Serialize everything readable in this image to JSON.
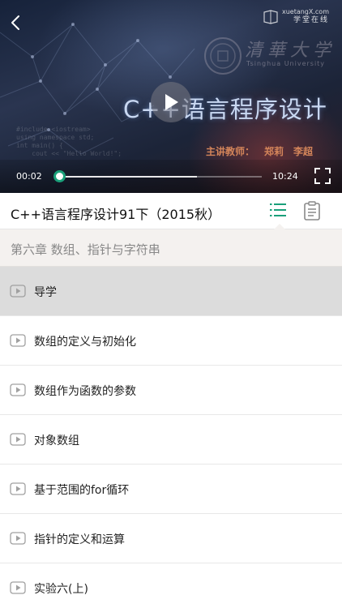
{
  "player": {
    "brand_en": "xuetangX.com",
    "brand_cn": "学堂在线",
    "university_cn": "清華大学",
    "university_en": "Tsinghua University",
    "video_title": "C++语言程序设计",
    "teacher_label": "主讲教师：",
    "teachers": [
      "郑莉",
      "李超"
    ],
    "current_time": "00:02",
    "total_time": "10:24",
    "progress": 0.0032,
    "buffered": 0.68,
    "accent_color": "#1aa07a",
    "icons": [
      "back-icon",
      "play-icon",
      "fullscreen-icon"
    ]
  },
  "course": {
    "title": "C++语言程序设计91下（2015秋）",
    "tabs": [
      {
        "name": "list-icon",
        "active": true,
        "color": "#1aa07a"
      },
      {
        "name": "notes-icon",
        "active": false,
        "color": "#888888"
      }
    ]
  },
  "chapter": {
    "title": "第六章 数组、指针与字符串"
  },
  "lessons": [
    {
      "label": "导学",
      "active": true
    },
    {
      "label": "数组的定义与初始化",
      "active": false
    },
    {
      "label": "数组作为函数的参数",
      "active": false
    },
    {
      "label": "对象数组",
      "active": false
    },
    {
      "label": "基于范围的for循环",
      "active": false
    },
    {
      "label": "指针的定义和运算",
      "active": false
    },
    {
      "label": "实验六(上)",
      "active": false
    }
  ]
}
